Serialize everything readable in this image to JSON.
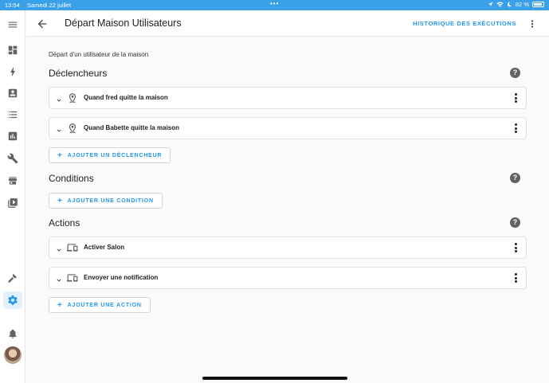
{
  "status_bar": {
    "time": "13:54",
    "date": "Samedi 22 juillet",
    "dots": "•••",
    "battery": "82 %"
  },
  "header": {
    "title": "Départ Maison Utilisateurs",
    "history_label": "HISTORIQUE DES EXÉCUTIONS"
  },
  "description": "Départ d'un utilisateur de la maison",
  "triggers": {
    "title": "Déclencheurs",
    "help": "?",
    "items": [
      {
        "label": "Quand fred quitte la maison",
        "icon": "map-marker-icon"
      },
      {
        "label": "Quand Babette quitte la maison",
        "icon": "map-marker-icon"
      }
    ],
    "add_label": "AJOUTER UN DÉCLENCHEUR"
  },
  "conditions": {
    "title": "Conditions",
    "help": "?",
    "add_label": "AJOUTER UNE CONDITION"
  },
  "actions": {
    "title": "Actions",
    "help": "?",
    "items": [
      {
        "label": "Activer Salon",
        "icon": "devices-icon"
      },
      {
        "label": "Envoyer une notification",
        "icon": "devices-icon"
      }
    ],
    "add_label": "AJOUTER UNE ACTION"
  },
  "colors": {
    "accent": "#2196f3",
    "status_bar": "#3aa0e8"
  }
}
